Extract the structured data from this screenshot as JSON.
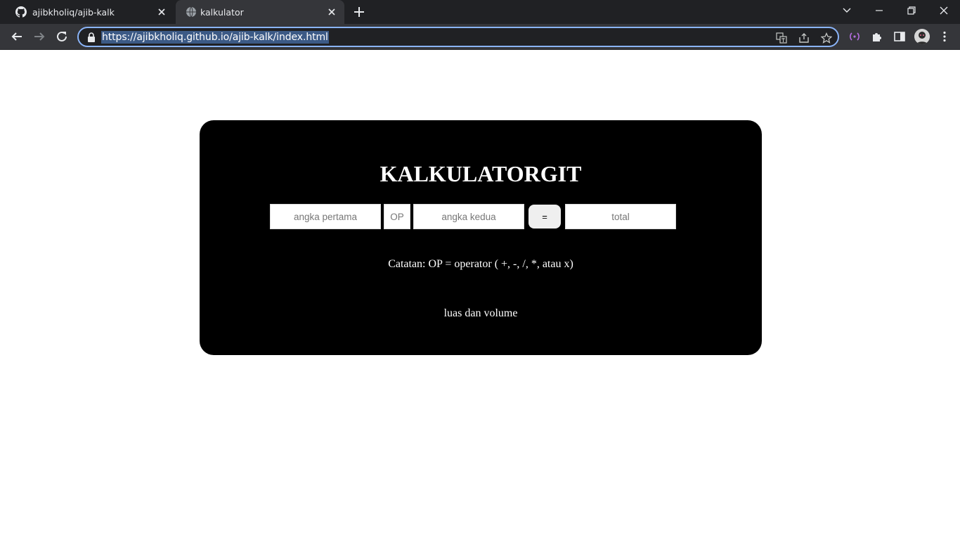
{
  "browser": {
    "tabs": [
      {
        "title": "ajibkholiq/ajib-kalk",
        "icon": "github-icon"
      },
      {
        "title": "kalkulator",
        "icon": "globe-icon"
      }
    ],
    "url": "https://ajibkholiq.github.io/ajib-kalk/index.html",
    "window_controls": [
      "tab-search-icon",
      "minimize-icon",
      "restore-icon",
      "close-icon"
    ],
    "toolbar_icons": [
      "translate-icon",
      "share-icon",
      "bookmark-star-icon",
      "media-router-icon",
      "extensions-icon",
      "side-panel-icon",
      "profile-avatar",
      "menu-icon"
    ]
  },
  "page": {
    "heading": "KALKULATORGIT",
    "inputs": {
      "first_placeholder": "angka pertama",
      "operator_placeholder": "OP",
      "second_placeholder": "angka kedua",
      "total_placeholder": "total"
    },
    "equals_label": "=",
    "note": "Catatan: OP = operator ( +, -, /, *, atau x)",
    "link_label": "luas dan volume"
  },
  "colors": {
    "card_background": "#000000",
    "page_background": "#ffffff",
    "tabstrip": "#202124",
    "toolbar": "#35363a",
    "omnibox_focus": "#8ab4f8"
  }
}
